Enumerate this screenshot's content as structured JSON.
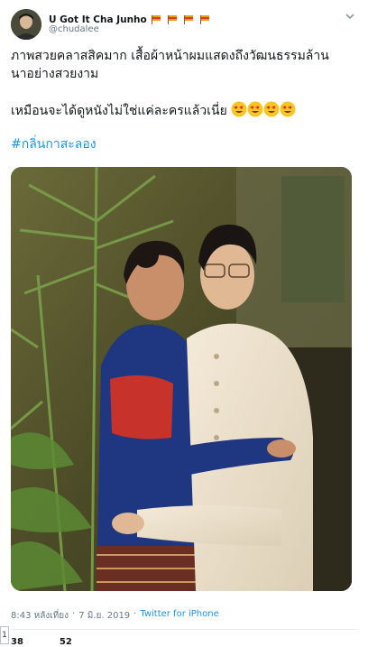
{
  "user": {
    "display_name": "U Got It Cha Junho",
    "handle": "@chudalee"
  },
  "tweet": {
    "line1": "ภาพสวยคลาสสิคมาก เสื้อผ้าหน้าผมแสดงถึงวัฒนธรรมล้าน",
    "line2": "นาอย่างสวยงาม",
    "line3": "เหมือนจะได้ดูหนังไม่ใช่แค่ละครแล้วเนี่ย",
    "hashtag": "#กลิ่นกาสะลอง"
  },
  "meta": {
    "time": "8:43 หลังเที่ยง",
    "separator": "·",
    "date": "7 มิ.ย. 2019",
    "separator2": "·",
    "source": "Twitter for iPhone"
  },
  "counts": {
    "retweets": "38",
    "likes": "52"
  },
  "scroll_tab_label": "1",
  "colors": {
    "link": "#1b95e0",
    "secondary": "#657786",
    "divider": "#e6ecf0"
  },
  "icons": [
    "avatar",
    "flag-emoji",
    "chevron-down-icon",
    "heart-eyes-emoji"
  ]
}
